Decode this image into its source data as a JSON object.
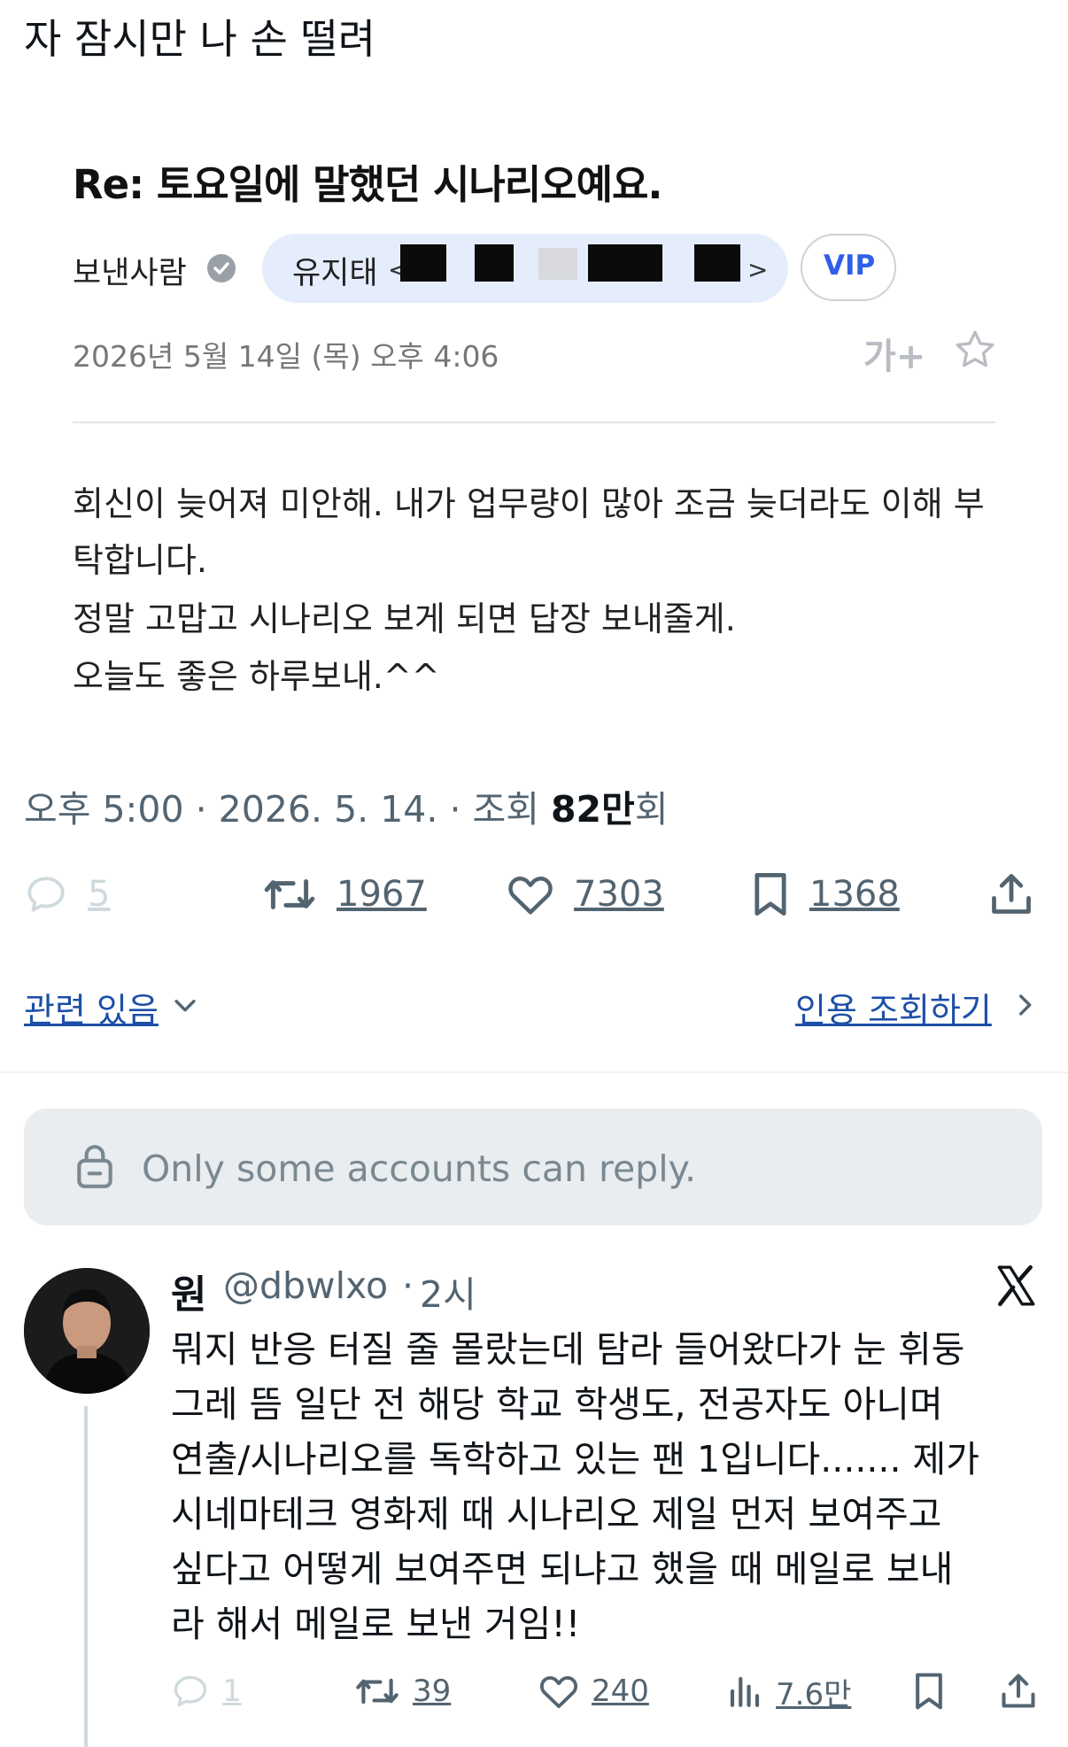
{
  "post": {
    "title": "자 잠시만 나 손 떨려"
  },
  "email": {
    "subject": "Re: 토요일에 말했던 시나리오예요.",
    "sender_label": "보낸사람",
    "sender_name": "유지태",
    "sender_bracket_open": "<",
    "sender_bracket_close": ">",
    "vip_label": "VIP",
    "date": "2026년 5월 14일 (목) 오후 4:06",
    "font_size_label": "가+",
    "body_lines": [
      "회신이 늦어져 미안해. 내가 업무량이 많아 조금 늦더라도 이해 부",
      "탁합니다.",
      "정말 고맙고 시나리오 보게 되면 답장 보내줄게.",
      "오늘도 좋은 하루보내.^^"
    ]
  },
  "tweet": {
    "time": "오후 5:00",
    "sep": " · ",
    "date": "2026. 5. 14.",
    "views_label": "조회",
    "views_number": "82만",
    "views_suffix": "회",
    "actions": {
      "reply": "5",
      "retweet": "1967",
      "like": "7303",
      "bookmark": "1368"
    },
    "related_link": "관련 있음",
    "quote_link": "인용 조회하기",
    "reply_restriction": "Only some accounts can reply."
  },
  "reply": {
    "name": "원",
    "handle": "@dbwlxo",
    "sep": "·",
    "time": "2시",
    "lines": [
      "뭐지 반응 터질 줄 몰랐는데 탐라 들어왔다가 눈 휘둥",
      "그레 뜸 일단 전 해당 학교 학생도, 전공자도 아니며",
      "연출/시나리오를 독학하고 있는 팬 1입니다....... 제가",
      "시네마테크 영화제 때 시나리오 제일 먼저 보여주고",
      "싶다고 어떻게 보여주면 되냐고 했을 때 메일로 보내",
      "라 해서 메일로 보낸 거임!!"
    ],
    "actions": {
      "reply": "1",
      "retweet": "39",
      "like": "240",
      "views": "7.6만"
    }
  },
  "icons": {
    "verified": "verified-icon",
    "star": "star-icon",
    "font_size": "font-size-icon",
    "reply": "reply-icon",
    "retweet": "retweet-icon",
    "like": "heart-icon",
    "bookmark": "bookmark-icon",
    "share": "share-icon",
    "views": "views-icon",
    "lock": "lock-icon",
    "x_logo": "x-logo-icon",
    "chevron_down": "chevron-down-icon",
    "chevron_right": "chevron-right-icon"
  },
  "colors": {
    "vip": "#2f5ee8",
    "link": "#1d4fa8",
    "muted": "#536471",
    "sender_pill": "#e5ecfc",
    "banner": "#e9edf0"
  }
}
